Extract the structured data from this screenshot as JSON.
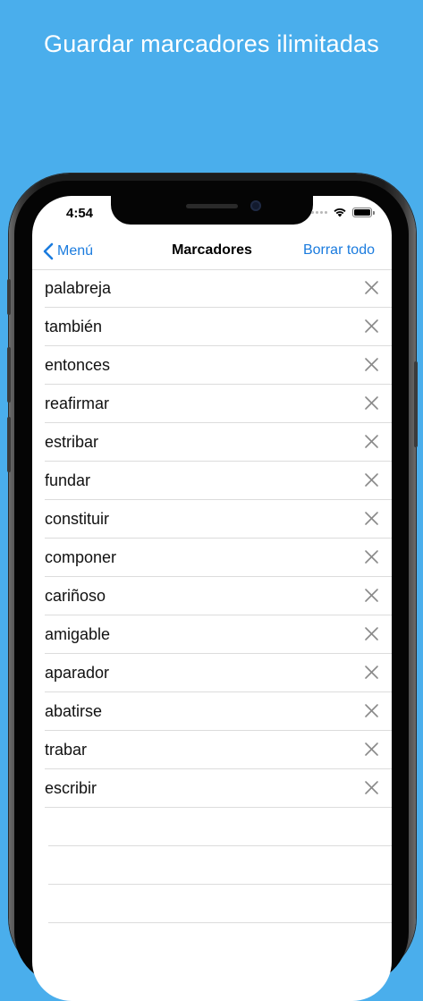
{
  "headline": "Guardar marcadores ilimitadas",
  "status_bar": {
    "time": "4:54"
  },
  "nav": {
    "back_label": "Menú",
    "title": "Marcadores",
    "action_label": "Borrar todo"
  },
  "bookmarks": [
    "palabreja",
    "también",
    "entonces",
    "reafirmar",
    "estribar",
    "fundar",
    "constituir",
    "componer",
    "cariñoso",
    "amigable",
    "aparador",
    "abatirse",
    "trabar",
    "escribir"
  ],
  "icons": {
    "back": "chevron-left-icon",
    "delete": "close-icon",
    "wifi": "wifi-icon",
    "battery": "battery-icon"
  },
  "colors": {
    "background": "#4aaeec",
    "accent": "#1a7bde"
  }
}
